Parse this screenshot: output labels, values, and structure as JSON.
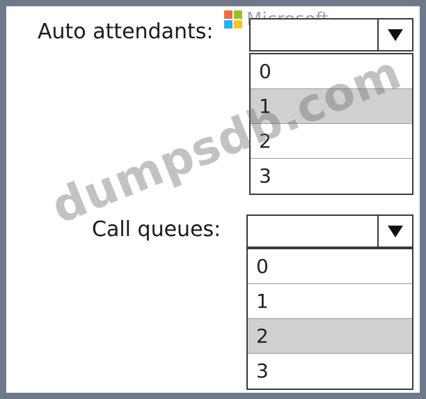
{
  "logo_text": "Microsoft",
  "watermark_text": "dumpsdb.com",
  "colors": {
    "frame": "#6e7a8a",
    "selected_option": "#d0d0d0",
    "logo_red": "#f25022",
    "logo_green": "#7fba00",
    "logo_blue": "#00a4ef",
    "logo_yellow": "#ffb900"
  },
  "auto_attendants": {
    "label": "Auto attendants:",
    "selected_value": "",
    "dropdown_icon": "triangle-down-icon",
    "options": [
      "0",
      "1",
      "2",
      "3"
    ],
    "highlighted_option": "1"
  },
  "call_queues": {
    "label": "Call queues:",
    "selected_value": "",
    "dropdown_icon": "triangle-down-icon",
    "options": [
      "0",
      "1",
      "2",
      "3"
    ],
    "highlighted_option": "2"
  }
}
